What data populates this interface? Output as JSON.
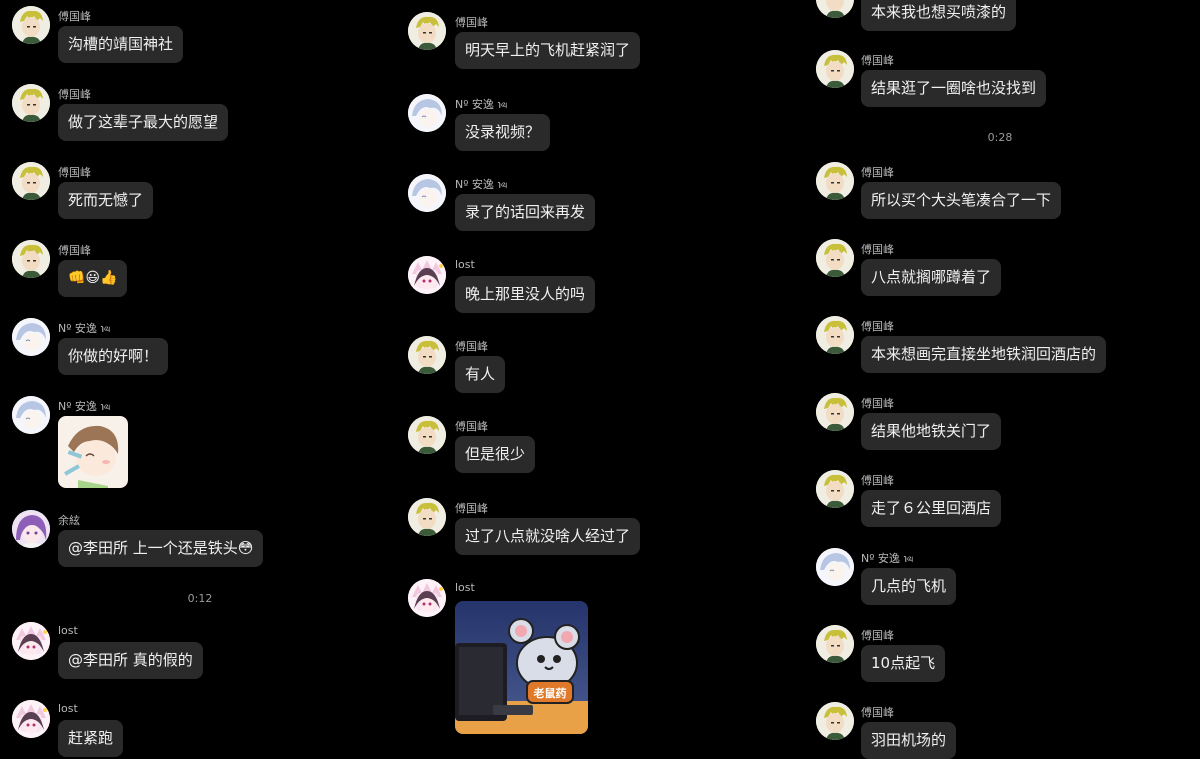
{
  "users": {
    "fu": "傅国峰",
    "an": "Nº 安逸 ℩ᤓ",
    "yu": "余絃",
    "lost": "lost"
  },
  "col1": {
    "m1": {
      "name": "傅国峰",
      "text": "沟槽的靖国神社"
    },
    "m2": {
      "name": "傅国峰",
      "text": "做了这辈子最大的愿望"
    },
    "m3": {
      "name": "傅国峰",
      "text": "死而无憾了"
    },
    "m4": {
      "name": "傅国峰",
      "text": "👊😃👍"
    },
    "m5": {
      "name": "Nº 安逸 ℩ᤓ",
      "text": "你做的好啊！"
    },
    "m6": {
      "name": "Nº 安逸 ℩ᤓ"
    },
    "m7": {
      "name": "余絃",
      "text": "@李田所 上一个还是铁头😳"
    },
    "time1": "0:12",
    "m8": {
      "name": "lost",
      "text": "@李田所 真的假的"
    },
    "m9": {
      "name": "lost",
      "text": "赶紧跑"
    }
  },
  "col2": {
    "m1": {
      "name": "傅国峰",
      "text": "明天早上的飞机赶紧润了"
    },
    "m2": {
      "name": "Nº 安逸 ℩ᤓ",
      "text": "没录视频？"
    },
    "m3": {
      "name": "Nº 安逸 ℩ᤓ",
      "text": "录了的话回来再发"
    },
    "m4": {
      "name": "lost",
      "text": "晚上那里没人的吗"
    },
    "m5": {
      "name": "傅国峰",
      "text": "有人"
    },
    "m6": {
      "name": "傅国峰",
      "text": "但是很少"
    },
    "m7": {
      "name": "傅国峰",
      "text": "过了八点就没啥人经过了"
    },
    "m8": {
      "name": "lost",
      "sticker_text": "老鼠药"
    }
  },
  "col3": {
    "m0": {
      "text": "本来我也想买喷漆的"
    },
    "m1": {
      "name": "傅国峰",
      "text": "结果逛了一圈啥也没找到"
    },
    "time1": "0:28",
    "m2": {
      "name": "傅国峰",
      "text": "所以买个大头笔凑合了一下"
    },
    "m3": {
      "name": "傅国峰",
      "text": "八点就搁哪蹲着了"
    },
    "m4": {
      "name": "傅国峰",
      "text": "本来想画完直接坐地铁润回酒店的"
    },
    "m5": {
      "name": "傅国峰",
      "text": "结果他地铁关门了"
    },
    "m6": {
      "name": "傅国峰",
      "text": "走了６公里回酒店"
    },
    "m7": {
      "name": "Nº 安逸 ℩ᤓ",
      "text": "几点的飞机"
    },
    "m8": {
      "name": "傅国峰",
      "text": "10点起飞"
    },
    "m9": {
      "name": "傅国峰",
      "text": "羽田机场的"
    }
  }
}
